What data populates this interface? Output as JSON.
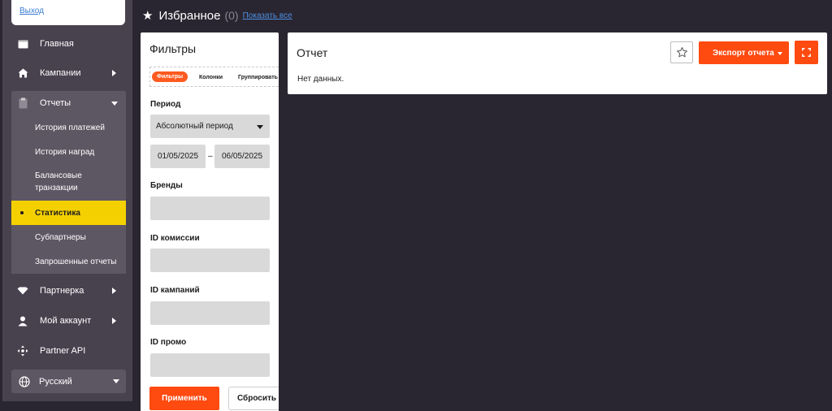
{
  "sidebar": {
    "logout_label": "Выход",
    "items": [
      {
        "label": "Главная",
        "icon": "home-window-icon"
      },
      {
        "label": "Кампании",
        "icon": "house-icon"
      },
      {
        "label": "Отчеты",
        "icon": "clipboard-icon"
      },
      {
        "label": "Партнерка",
        "icon": "diamond-icon"
      },
      {
        "label": "Мой аккаунт",
        "icon": "user-icon"
      },
      {
        "label": "Partner API",
        "icon": "api-icon"
      }
    ],
    "report_subitems": [
      {
        "label": "История платежей"
      },
      {
        "label": "История наград"
      },
      {
        "label": "Балансовые транзакции"
      },
      {
        "label": "Статистика",
        "active": true
      },
      {
        "label": "Субпартнеры"
      },
      {
        "label": "Запрошенные отчеты"
      }
    ],
    "language": "Русский"
  },
  "favorites": {
    "title": "Избранное",
    "count": "(0)",
    "show_all": "Показать все"
  },
  "filters": {
    "title": "Фильтры",
    "tabs": [
      "Фильтры",
      "Колонки",
      "Группировать"
    ],
    "period_label": "Период",
    "period_value": "Абсолютный период",
    "date_from": "01/05/2025",
    "date_sep": "–",
    "date_to": "06/05/2025",
    "brands_label": "Бренды",
    "commission_label": "ID комиссии",
    "campaigns_label": "ID кампаний",
    "promo_label": "ID промо",
    "apply_label": "Применить",
    "reset_label": "Сбросить"
  },
  "report": {
    "title": "Отчет",
    "empty_text": "Нет данных.",
    "export_label": "Экспорт отчета"
  },
  "colors": {
    "accent": "#ff4a10",
    "active_nav": "#f5d000",
    "sidebar_bg": "#48424f",
    "page_bg": "#2a2631"
  }
}
